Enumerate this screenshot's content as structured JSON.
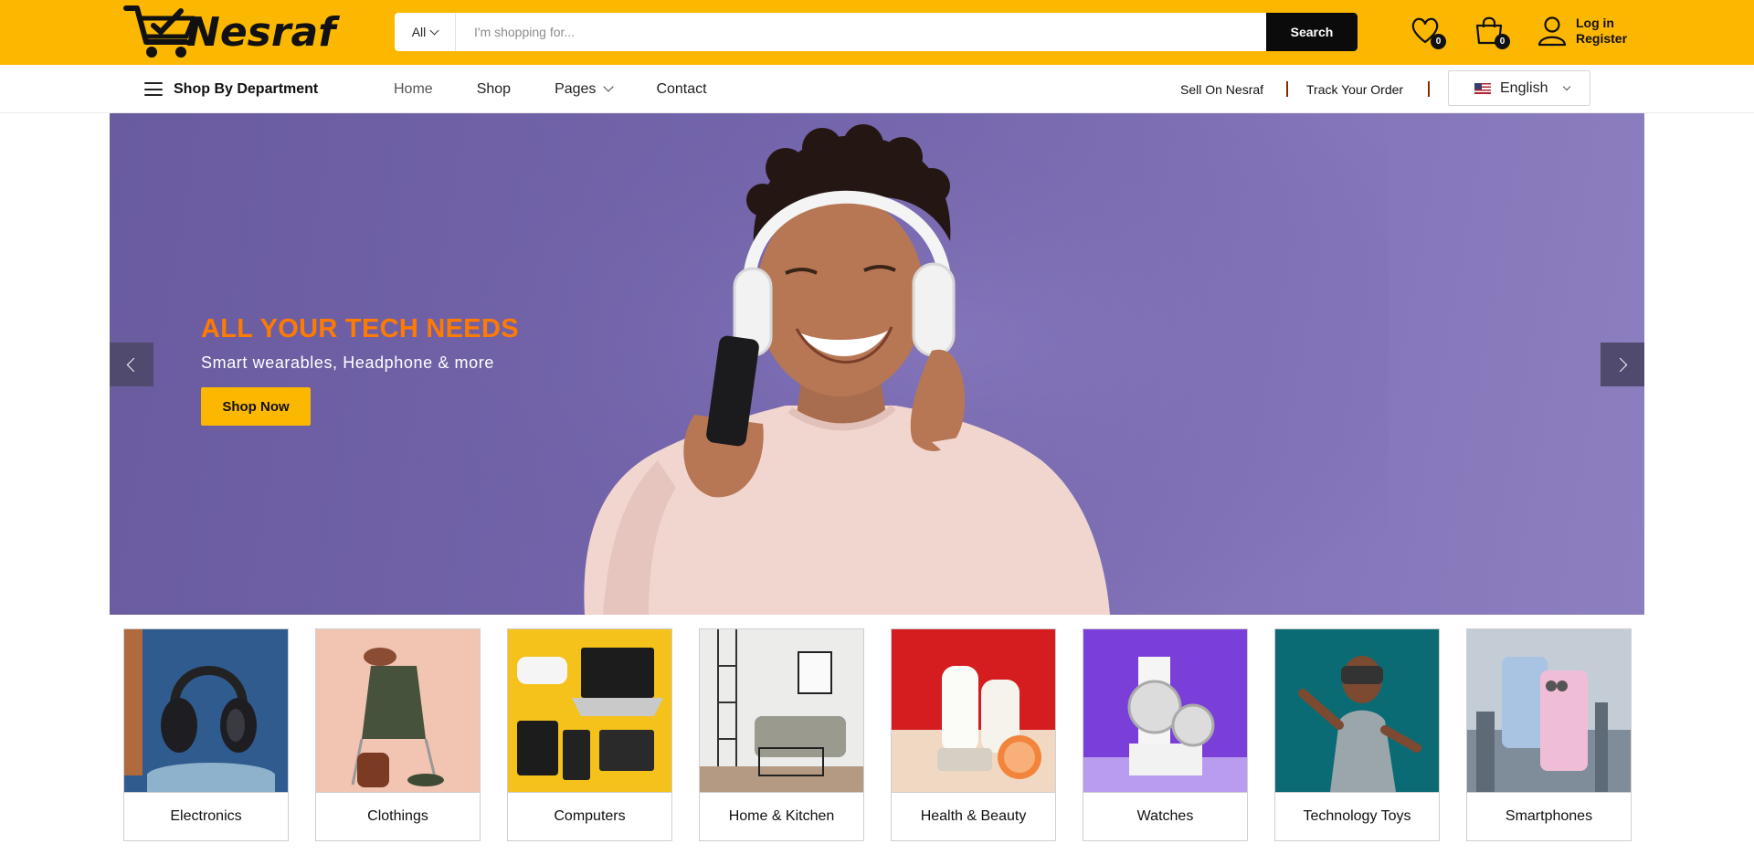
{
  "brand": {
    "name": "Nesraf"
  },
  "search": {
    "category": "All",
    "placeholder": "I'm shopping for...",
    "button": "Search"
  },
  "header": {
    "wishlist_count": "0",
    "cart_count": "0",
    "login_label": "Log in",
    "register_label": "Register"
  },
  "nav": {
    "department": "Shop By Department",
    "menu": [
      "Home",
      "Shop",
      "Pages",
      "Contact"
    ],
    "sell": "Sell On Nesraf",
    "track": "Track Your Order",
    "language": "English"
  },
  "hero": {
    "title": "ALL YOUR TECH NEEDS",
    "subtitle": "Smart wearables, Headphone & more",
    "button": "Shop Now"
  },
  "categories": [
    "Electronics",
    "Clothings",
    "Computers",
    "Home & Kitchen",
    "Health & Beauty",
    "Watches",
    "Technology Toys",
    "Smartphones"
  ],
  "colors": {
    "brand_yellow": "#fcb700",
    "hero_bg": "#7566ad",
    "hero_title": "#ff7b00",
    "dark": "#0b0b0b"
  },
  "icons": [
    "cart-logo-icon",
    "heart-icon",
    "bag-icon",
    "user-icon",
    "hamburger-icon",
    "chevron-down-icon",
    "us-flag-icon",
    "chevron-left-icon",
    "chevron-right-icon"
  ]
}
